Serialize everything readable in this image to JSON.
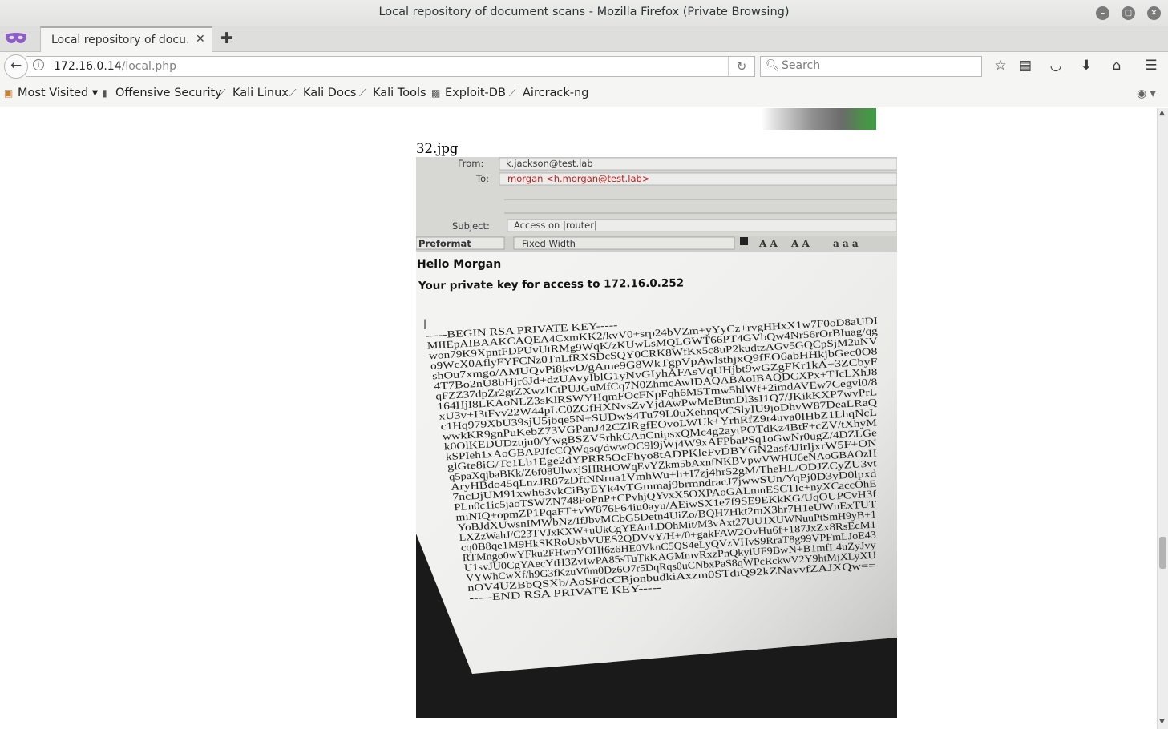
{
  "window": {
    "title": "Local repository of document scans - Mozilla Firefox (Private Browsing)"
  },
  "tab": {
    "label": "Local repository of docu…",
    "close_icon": "close-icon"
  },
  "nav": {
    "url_host": "172.16.0.14",
    "url_path": "/local.php",
    "search_placeholder": "Search"
  },
  "bookmarks": {
    "items": [
      {
        "label": "Most Visited ▾",
        "icon": "star-folder-icon"
      },
      {
        "label": "Offensive Security",
        "icon": "offsec-icon"
      },
      {
        "label": "Kali Linux",
        "icon": "kali-dragon-icon"
      },
      {
        "label": "Kali Docs",
        "icon": "kali-dragon-icon"
      },
      {
        "label": "Kali Tools",
        "icon": "kali-dragon-icon"
      },
      {
        "label": "Exploit-DB",
        "icon": "exploitdb-icon"
      },
      {
        "label": "Aircrack-ng",
        "icon": "aircrack-icon"
      }
    ]
  },
  "content": {
    "image_caption": "32.jpg"
  },
  "photo": {
    "from_label": "From:",
    "from_value": "k.jackson@test.lab",
    "to_label": "To:",
    "to_value": "morgan <h.morgan@test.lab>",
    "subject_label": "Subject:",
    "subject_value": "Access on |router|",
    "format_select": "Preformat",
    "font_select": "Fixed Width",
    "greeting": "Hello Morgan",
    "intro": "Your private key for access to 172.16.0.252",
    "cursor": "|",
    "key_lines": [
      "-----BEGIN RSA PRIVATE KEY-----",
      "MIIEpAIBAAKCAQEA4CxmKK2/kvV0+srp24bVZm+yYyCz+rvgHHxX1w7F0oD8aUDI",
      "won79K9XpntFDPUvUtRMg9WqK/zKUwLsMQLGWT66PT4GVbQw4Nr56rOrBIuag/qg",
      "o9WcX0AflyFYFCNz0TnLfRXSDcSQY0CRK8WfKx5c8uP2kudtzAGv5GQCpSjM2uNV",
      "shOu7xmgo/AMUQvPi8kvD/gAme9G8WkTgpVpAwlsthjxQ9fEO6abHHkjbGec0O8",
      "4T7Bo2nU8bHjr6Jd+dzUAvyIblG1yNvGIyhAFAsVqUHjbt9wGZgFKr1kA+3ZCbyF",
      "qFZZ37dpZr2grZXwzICtPUJGuMfCq7N0ZhmcAwIDAQABAoIBAQDCXPx+TJcLXhJ8",
      "164HjI8LKAoNLZ3sKlRSWYHqmFOcFNpFqh6M5Tmw5hlWf+2imdAVEw7Cegvl0/8",
      "xU3v+I3tFvv22W44pLC0ZGfHXNvsZvYjdAwPwMeBtmDl3sI1Q7/JKikKXP7wvPrL",
      "c1Hq979XbU39sjU5jbqe5N+SUDwS4Tu79L0uXehnqvCSlyIU9joDhvW87DeaLRaQ",
      "wwkKR9gnPuKebZ73VGPanJ42CZlRgfEOvoLWUk+YrhRfZ9r4uva0IHbZ1LhqNcL",
      "k0OlKEDUDzuju0/YwgBSZVSrhkCAnCnipsxQMc4g2aytPOTdKz4BtF+cZV/tXhyM",
      "kSPIeh1xAoGBAPJfcCQWqsq/dwwOC9l9jWj4W9xAFPbaPSq1oGwNr0ugZ/4DZLGe",
      "glGte8iG/Tc1Lb1Ege2dYPRR5OcFhyo8tADPKleFvDBYGN2asf4JirljxrW5F+ON",
      "q5paXqjbaBKk/Z6f08UlwxjSHRHOWqEvYZkm5bAxnfNKBVpwVWHU6eNAoGBAOzH",
      "AryHBdo45qLnzJR87zDftNNrua1VmhWu+h+I7zj4hr52gM/TheHL/ODJZCyZU3vt",
      "7ncDjUM91xwh63vkCiByEYk4vTGmmaj9brmndracJ7jwwSUn/YqPj0D3yD0lpxd",
      "PLn0c1ic5jaoTSWZN748PoPnP+CPvhjQYvxX5OXPAoGALmnESCTIc+nyXCaccOhE",
      "miNIQ+opmZP1PqaFT+vW876F64iu0ayu/AEiwSX1e7f9SE9EKkKG/UqOUPCvH3f",
      "YoBJdXUwsnIMWbNz/IfJbvMCbG5Detn4UiZo/BQH7Hkt2mX3hr7H1eUWnExTUT",
      "LXZzWahJ/C23TVJxKXW+uUkCgYEAnLDOhMit/M3vAxt27UU1XUWNuuPtSmH9yB+1",
      "cq0B8qe1M9HkSKRoUxbVUES2QDVvY/H+/0+gakFAW2OvHu6f+187JxZx8RsEcM1",
      "RTMngo0wYFku2FHwnYOHf6z6HE0VknC5QS4eLyQVzVHvS9RraT8g99VPFmLJoE43",
      "U1svJU0CgYAecYtH3ZvIwPA85sTuTkKAGMmvRxzPnQkyiUF9BwN+B1mfL4uZyJvy",
      "VYWhCwXf/h9G3fKzuV0m0Dz6O7r5DqRqs0uCNbxPaS8qWPcRckwV2Y9htMjXLyXU",
      "nOV4UZBbQSXb/AoSFdcCBjonbudkiAxzm0STdiQ92kZNavvfZAJXQw==",
      "-----END RSA PRIVATE KEY-----"
    ]
  }
}
